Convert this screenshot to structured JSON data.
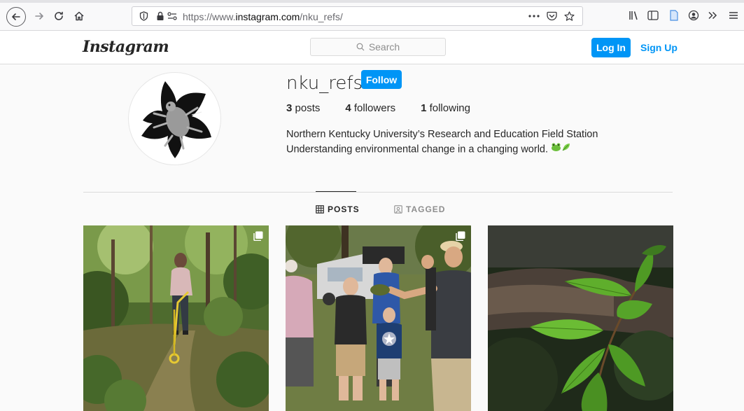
{
  "browser": {
    "url_scheme": "https://www.",
    "url_host": "instagram.com",
    "url_path": "/nku_refs/",
    "icons": [
      "back-icon",
      "forward-icon",
      "reload-icon",
      "home-icon",
      "shield-icon",
      "lock-icon",
      "permissions-icon",
      "page-actions-icon",
      "pocket-icon",
      "bookmark-star-icon",
      "library-icon",
      "sidebar-icon",
      "reader-icon",
      "account-icon",
      "overflow-icon",
      "menu-icon"
    ]
  },
  "header": {
    "logo": "Instagram",
    "search_placeholder": "Search",
    "login_label": "Log In",
    "signup_label": "Sign Up",
    "accent_color": "#0095f6"
  },
  "profile": {
    "username": "nku_refs",
    "follow_label": "Follow",
    "stats": {
      "posts_count": "3",
      "posts_label": " posts",
      "followers_count": "4",
      "followers_label": " followers",
      "following_count": "1",
      "following_label": " following"
    },
    "bio_line1": "Northern Kentucky University’s Research and Education Field Station",
    "bio_line2": "Understanding environmental change in a changing world. "
  },
  "tabs": {
    "posts_label": "POSTS",
    "tagged_label": "TAGGED"
  },
  "posts": [
    {
      "subject": "woman-with-measuring-wheel-in-forest",
      "multi": true
    },
    {
      "subject": "group-holding-turtle-outdoors",
      "multi": true
    },
    {
      "subject": "green-leaves-closeup",
      "multi": false
    }
  ]
}
